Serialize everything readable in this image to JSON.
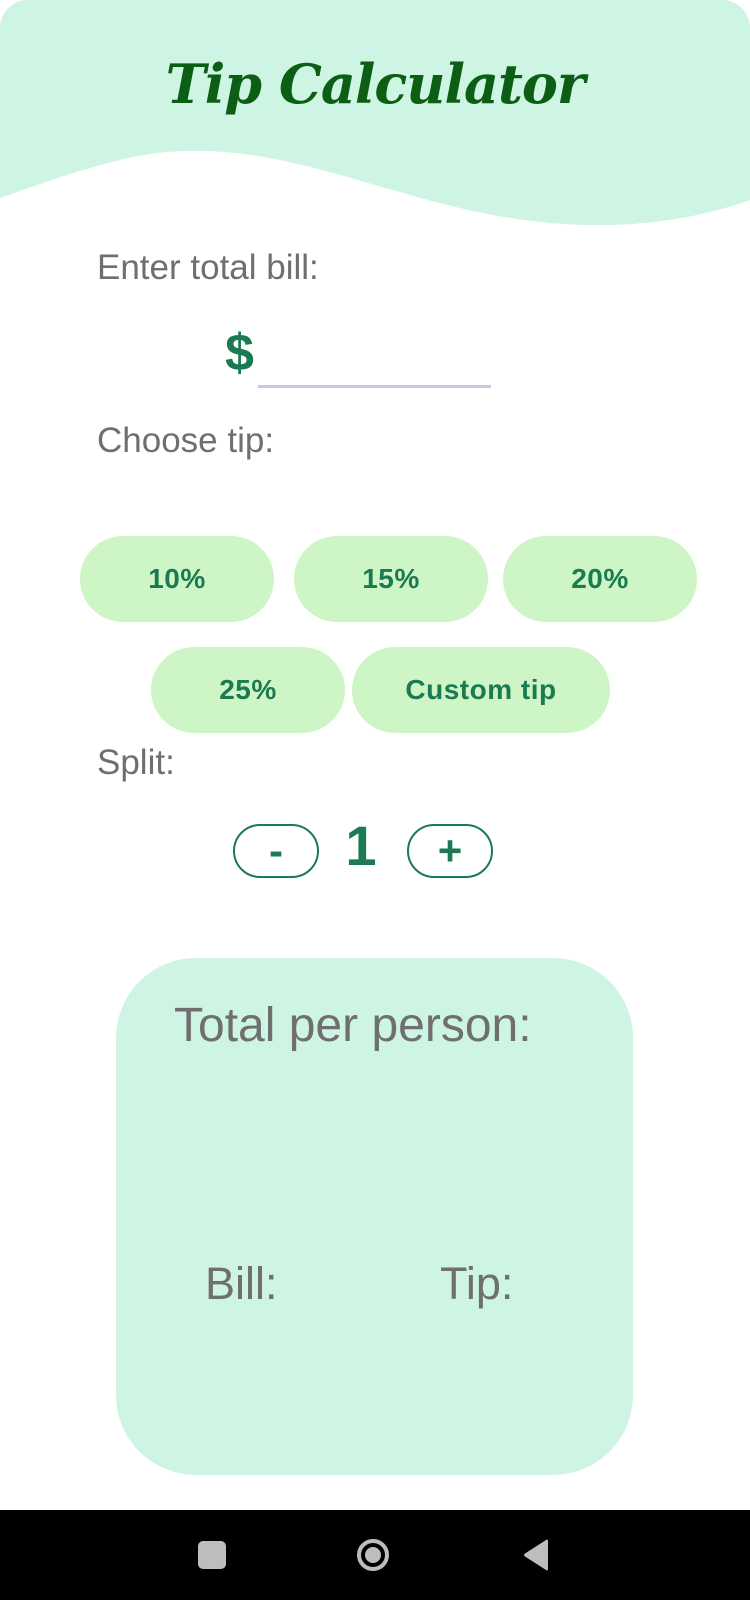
{
  "header": {
    "title": "Tip Calculator"
  },
  "bill": {
    "label": "Enter total bill:",
    "currency_symbol": "$",
    "value": ""
  },
  "tip": {
    "label": "Choose tip:",
    "options": [
      "10%",
      "15%",
      "20%",
      "25%"
    ],
    "custom_label": "Custom tip"
  },
  "split": {
    "label": "Split:",
    "minus_label": "-",
    "plus_label": "+",
    "value": "1"
  },
  "result": {
    "total_label": "Total per person:",
    "bill_label": "Bill:",
    "tip_label": "Tip:"
  },
  "colors": {
    "primary": "#1b7a52",
    "title": "#0b5e14",
    "header_bg": "#cef4e3",
    "tip_button_bg": "#cdf5c6",
    "card_bg": "#cef4e3",
    "label_text": "#6f6f6f"
  },
  "nav": {
    "recent_icon": "square-icon",
    "home_icon": "circle-home-icon",
    "back_icon": "triangle-back-icon"
  }
}
